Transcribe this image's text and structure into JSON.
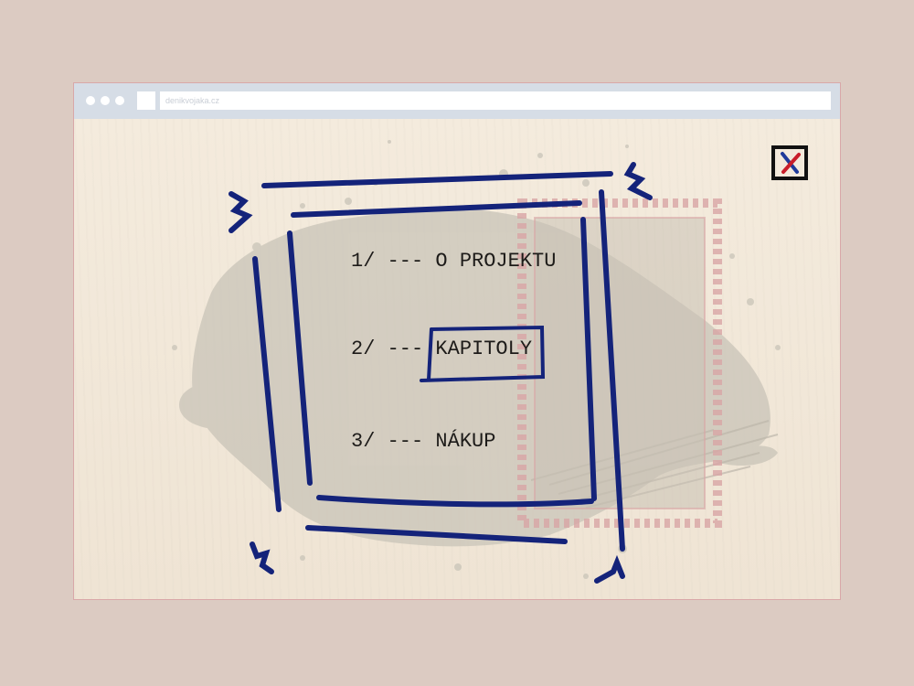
{
  "browser": {
    "url": "denikvojaka.cz"
  },
  "menu": {
    "items": [
      {
        "number": "1/",
        "separator": "---",
        "label": "O PROJEKTU"
      },
      {
        "number": "2/",
        "separator": "---",
        "label": "KAPITOLY"
      },
      {
        "number": "3/",
        "separator": "---",
        "label": "NÁKUP"
      }
    ]
  },
  "icons": {
    "close": "close-x-icon"
  },
  "colors": {
    "ink": "#14237a",
    "close_x_red": "#c81d2a",
    "close_x_blue": "#1f3a9a",
    "stamp": "#d8a5a5",
    "paper": "#f1e7d8"
  }
}
